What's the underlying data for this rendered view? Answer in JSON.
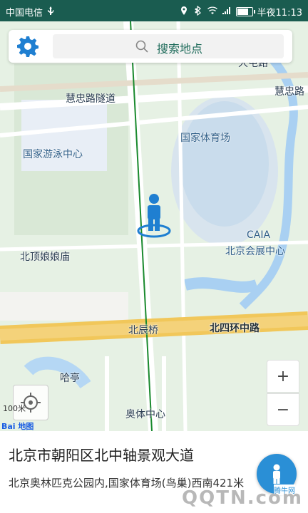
{
  "status": {
    "carrier": "中国电信",
    "usb_icon": "usb-icon",
    "time": "半夜11:13",
    "battery_level": 0.85
  },
  "search": {
    "placeholder": "搜索地点"
  },
  "map": {
    "labels": {
      "road_huizhong_left": "慧忠路隧道",
      "road_huizhong_right": "慧忠路",
      "stadium": "国家体育场",
      "swim": "国家游泳中心",
      "temple": "北顶娘娘庙",
      "caia": "CAIA",
      "expo": "北京会展中心",
      "beichen": "北辰桥",
      "fourth_ring": "北四环中路",
      "hating": "哈亭",
      "sports_center": "奥体中心",
      "top_right": "大屯路"
    },
    "scale_text": "100米",
    "logo_text": "Bai 地图"
  },
  "controls": {
    "zoom_in": "+",
    "zoom_out": "−"
  },
  "panel": {
    "title": "北京市朝阳区北中轴景观大道",
    "address": "北京奥林匹克公园内,国家体育场(鸟巢)西南421米"
  },
  "watermark": {
    "brand": "腾牛网",
    "site": "QQTN.com"
  },
  "colors": {
    "statusbar": "#1a5c50",
    "route": "#1a8a2e",
    "accent": "#2a8fd6"
  }
}
